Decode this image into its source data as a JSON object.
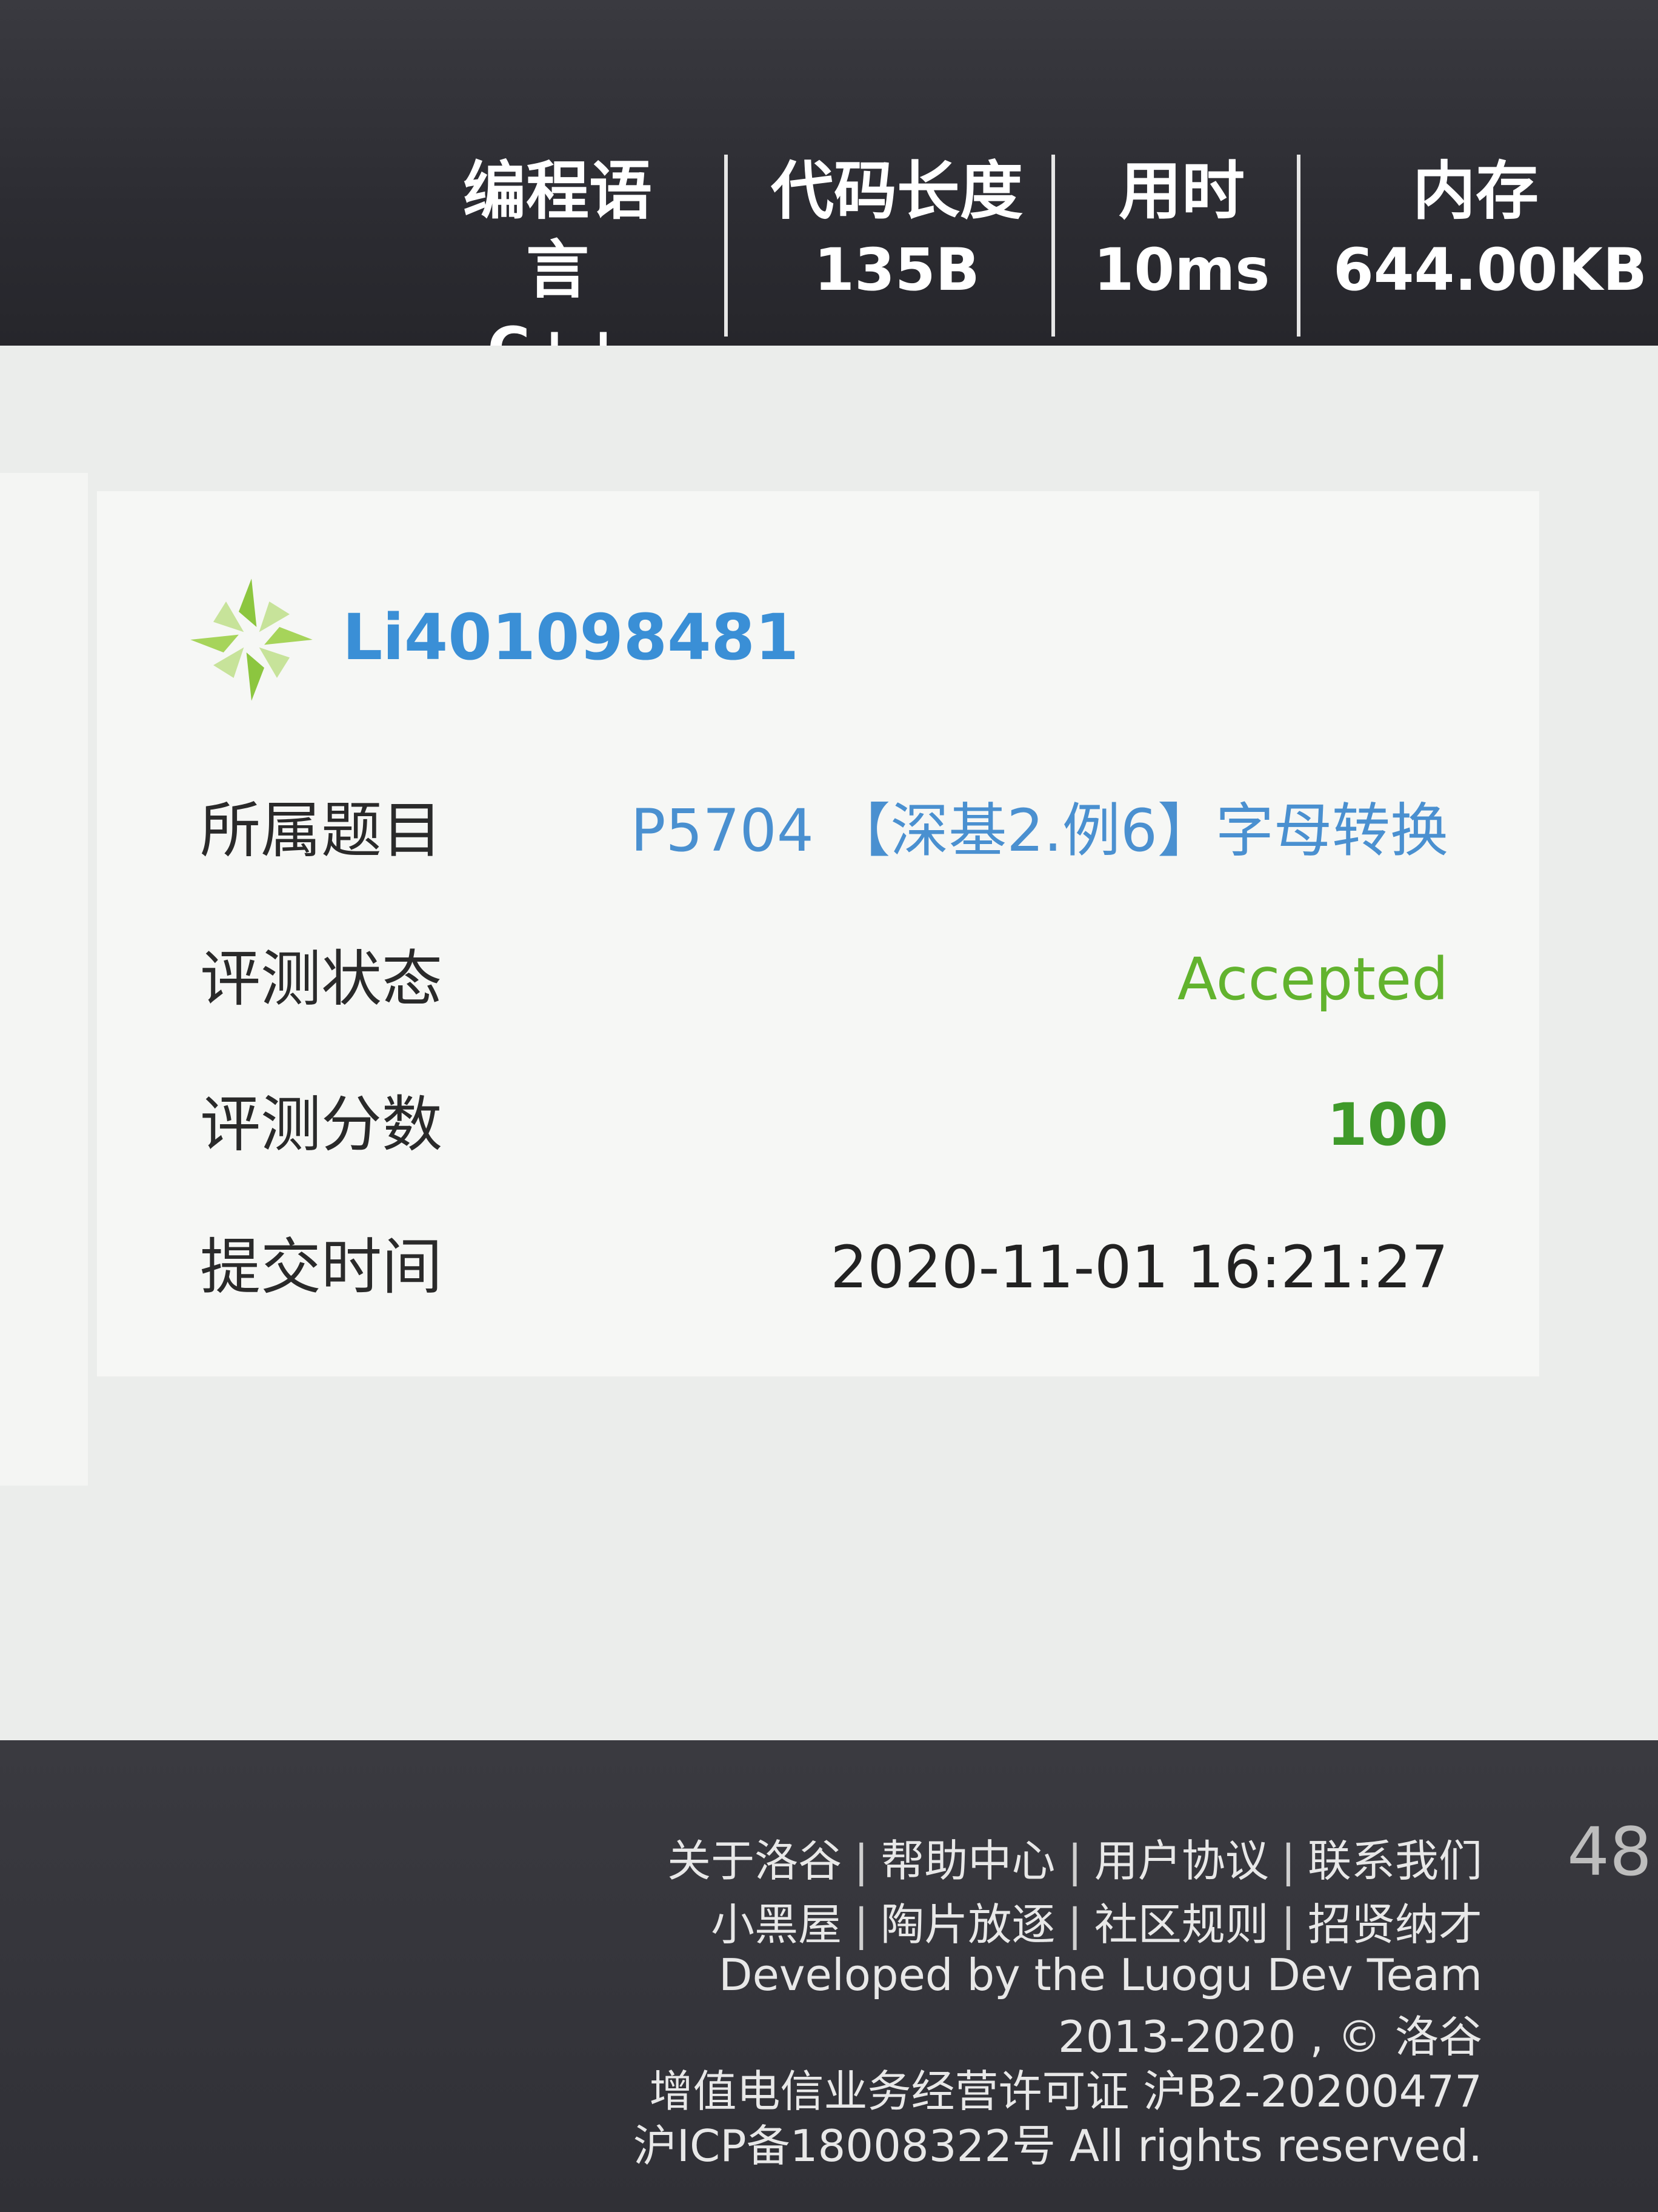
{
  "header": {
    "stats": [
      {
        "label": "编程语言",
        "value": "C++"
      },
      {
        "label": "代码长度",
        "value": "135B"
      },
      {
        "label": "用时",
        "value": "10ms"
      },
      {
        "label": "内存",
        "value": "644.00KB"
      }
    ]
  },
  "card": {
    "username": "Li401098481",
    "rows": [
      {
        "key": "所属题目",
        "value": "P5704 【深基2.例6】字母转换"
      },
      {
        "key": "评测状态",
        "value": "Accepted"
      },
      {
        "key": "评测分数",
        "value": "100"
      },
      {
        "key": "提交时间",
        "value": "2020-11-01 16:21:27"
      }
    ],
    "colors": {
      "username": "#3a8fd6",
      "link": "#4a90d0",
      "accepted": "#62b32e",
      "score": "#3f9a2a",
      "logo": "#8cc63f"
    }
  },
  "footer": {
    "links_row1": [
      "关于洛谷",
      "帮助中心",
      "用户协议",
      "联系我们"
    ],
    "links_row2": [
      "小黑屋",
      "陶片放逐",
      "社区规则",
      "招贤纳才"
    ],
    "developed_by": "Developed by the Luogu Dev Team",
    "copyright": "2013-2020 , © 洛谷",
    "license": "增值电信业务经营许可证 沪B2-20200477",
    "icp": "沪ICP备18008322号 All rights reserved.",
    "separator": "|"
  },
  "zoom_text": "48"
}
